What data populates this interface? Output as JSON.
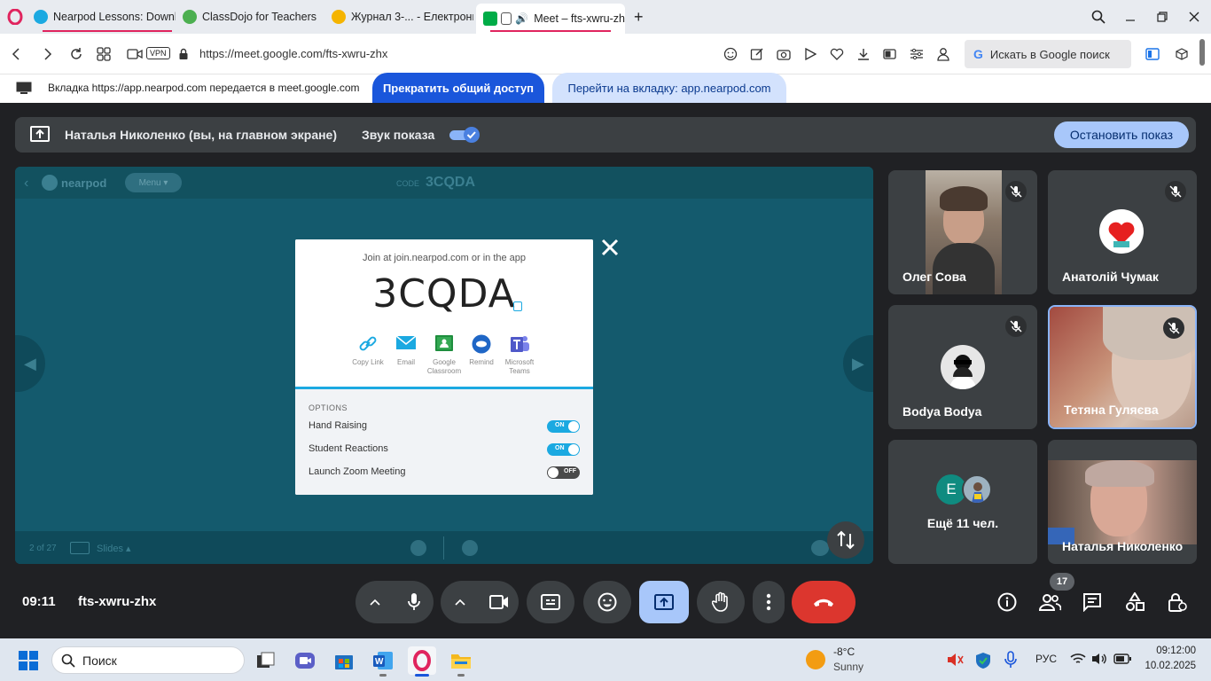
{
  "browser": {
    "tabs": [
      {
        "title": "Nearpod Lessons: Downlo",
        "icon": "nearpod-icon",
        "color": "#1ba9e1"
      },
      {
        "title": "ClassDojo for Teachers",
        "icon": "classdojo-icon",
        "color": "#4caf50"
      },
      {
        "title": "Журнал 3-... - Електронні",
        "icon": "sun-icon",
        "color": "#f5b400"
      },
      {
        "title": "Meet – fts-xwru-zh",
        "icon": "meet-icon",
        "color": "#00ac47"
      }
    ],
    "url": "https://meet.google.com/fts-xwru-zhx",
    "vpn_label": "VPN",
    "search_label": "Искать в Google поиск"
  },
  "share_banner": {
    "text": "Вкладка https://app.nearpod.com передается в meet.google.com",
    "stop_label": "Прекратить общий доступ",
    "goto_label": "Перейти на вкладку: app.nearpod.com"
  },
  "presentation_bar": {
    "presenter": "Наталья Николенко (вы, на главном экране)",
    "sound_label": "Звук показа",
    "stop_label": "Остановить показ"
  },
  "nearpod": {
    "brand": "nearpod",
    "menu_label": "Menu",
    "code_prefix": "CODE",
    "code_small": "3CQDA",
    "join_text": "Join at join.nearpod.com or in the app",
    "code": "3CQDA",
    "share_options": [
      {
        "label": "Copy Link",
        "icon": "link-icon"
      },
      {
        "label": "Email",
        "icon": "email-icon"
      },
      {
        "label": "Google Classroom",
        "icon": "google-classroom-icon"
      },
      {
        "label": "Remind",
        "icon": "remind-icon"
      },
      {
        "label": "Microsoft Teams",
        "icon": "teams-icon"
      }
    ],
    "options_title": "OPTIONS",
    "options": [
      {
        "label": "Hand Raising",
        "state": "ON"
      },
      {
        "label": "Student Reactions",
        "state": "ON"
      },
      {
        "label": "Launch Zoom Meeting",
        "state": "OFF"
      }
    ],
    "slide_counter": "2 of 27",
    "slides_label": "Slides"
  },
  "participants": [
    {
      "name": "Олег Сова",
      "muted": true
    },
    {
      "name": "Анатолій Чумак",
      "muted": true
    },
    {
      "name": "Bodya Bodya",
      "muted": true
    },
    {
      "name": "Тетяна Гуляєва",
      "muted": true
    },
    {
      "name": "Ещё 11 чел.",
      "initial": "E"
    },
    {
      "name": "Наталья Николенко"
    }
  ],
  "controls": {
    "time": "09:11",
    "meeting_code": "fts-xwru-zhx",
    "people_count": "17"
  },
  "taskbar": {
    "search_placeholder": "Поиск",
    "weather_temp": "-8°C",
    "weather_desc": "Sunny",
    "lang": "РУС",
    "time": "09:12:00",
    "date": "10.02.2025"
  }
}
